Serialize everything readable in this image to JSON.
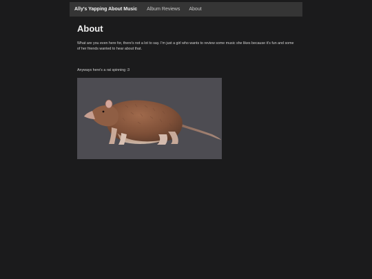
{
  "nav": {
    "brand": "Ally's Yapping About Music",
    "links": [
      "Album Reviews",
      "About"
    ]
  },
  "main": {
    "title": "About",
    "intro": "What are you even here for, there's not a lot to say. I'm just a girl who wants to review some music she likes because it's fun and some of her friends wanted to hear about that.",
    "caption": "Anyways here's a rat spinning :3",
    "media": {
      "icon": "rat-3d-model",
      "background": "#4d4c52"
    }
  },
  "colors": {
    "page_background": "#1b1b1c",
    "navbar_background": "#353535",
    "text": "#d2d2d2"
  }
}
